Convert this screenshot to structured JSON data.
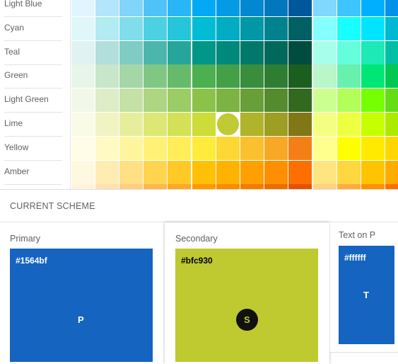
{
  "palette": {
    "selected": {
      "row": 5,
      "col": 6
    },
    "rows": [
      {
        "label": "Light Blue",
        "colors": [
          "#E1F5FE",
          "#B3E5FC",
          "#81D4FA",
          "#4FC3F7",
          "#29B6F6",
          "#03A9F4",
          "#039BE5",
          "#0288D1",
          "#0277BD",
          "#01579B",
          "#80D8FF",
          "#40C4FF",
          "#00B0FF",
          "#0091EA"
        ]
      },
      {
        "label": "Cyan",
        "colors": [
          "#E0F7FA",
          "#B2EBF2",
          "#80DEEA",
          "#4DD0E1",
          "#26C6DA",
          "#00BCD4",
          "#00ACC1",
          "#0097A7",
          "#00838F",
          "#006064",
          "#84FFFF",
          "#18FFFF",
          "#00E5FF",
          "#00B8D4"
        ]
      },
      {
        "label": "Teal",
        "colors": [
          "#E0F2F1",
          "#B2DFDB",
          "#80CBC4",
          "#4DB6AC",
          "#26A69A",
          "#009688",
          "#00897B",
          "#00796B",
          "#00695C",
          "#004D40",
          "#A7FFEB",
          "#64FFDA",
          "#1DE9B6",
          "#00BFA5"
        ]
      },
      {
        "label": "Green",
        "colors": [
          "#E8F5E9",
          "#C8E6C9",
          "#A5D6A7",
          "#81C784",
          "#66BB6A",
          "#4CAF50",
          "#43A047",
          "#388E3C",
          "#2E7D32",
          "#1B5E20",
          "#B9F6CA",
          "#69F0AE",
          "#00E676",
          "#00C853"
        ]
      },
      {
        "label": "Light Green",
        "colors": [
          "#F1F8E9",
          "#DCEDC8",
          "#C5E1A5",
          "#AED581",
          "#9CCC65",
          "#8BC34A",
          "#7CB342",
          "#689F38",
          "#558B2F",
          "#33691E",
          "#CCFF90",
          "#B2FF59",
          "#76FF03",
          "#64DD17"
        ]
      },
      {
        "label": "Lime",
        "colors": [
          "#F9FBE7",
          "#F0F4C3",
          "#E6EE9C",
          "#DCE775",
          "#D4E157",
          "#CDDC39",
          "#C0CA33",
          "#AFB42B",
          "#9E9D24",
          "#827717",
          "#F4FF81",
          "#EEFF41",
          "#C6FF00",
          "#AEEA00"
        ]
      },
      {
        "label": "Yellow",
        "colors": [
          "#FFFDE7",
          "#FFF9C4",
          "#FFF59D",
          "#FFF176",
          "#FFEE58",
          "#FFEB3B",
          "#FDD835",
          "#FBC02D",
          "#F9A825",
          "#F57F17",
          "#FFFF8D",
          "#FFFF00",
          "#FFEA00",
          "#FFD600"
        ]
      },
      {
        "label": "Amber",
        "colors": [
          "#FFF8E1",
          "#FFECB3",
          "#FFE082",
          "#FFD54F",
          "#FFCA28",
          "#FFC107",
          "#FFB300",
          "#FFA000",
          "#FF8F00",
          "#FF6F00",
          "#FFE57F",
          "#FFD740",
          "#FFC400",
          "#FFAB00"
        ]
      },
      {
        "colors": [
          "#FFF3E0",
          "#FFE0B2",
          "#FFCC80",
          "#FFB74D",
          "#FFA726",
          "#FF9800",
          "#FB8C00",
          "#F57C00",
          "#EF6C00",
          "#E65100",
          "#FFD180",
          "#FFAB40",
          "#FF9100",
          "#FF6D00"
        ]
      }
    ]
  },
  "scheme": {
    "title": "CURRENT SCHEME",
    "primary": {
      "label": "Primary",
      "hex": "#1564bf",
      "letter": "P",
      "color": "#1564bf",
      "text_color": "#ffffff"
    },
    "secondary": {
      "label": "Secondary",
      "hex": "#bfc930",
      "letter": "S",
      "color": "#bfc930",
      "text_color": "#000000"
    },
    "text_on_primary": {
      "label": "Text on P",
      "hex": "#ffffff",
      "letter": "T",
      "color": "#1564bf",
      "text_color": "#ffffff"
    }
  }
}
